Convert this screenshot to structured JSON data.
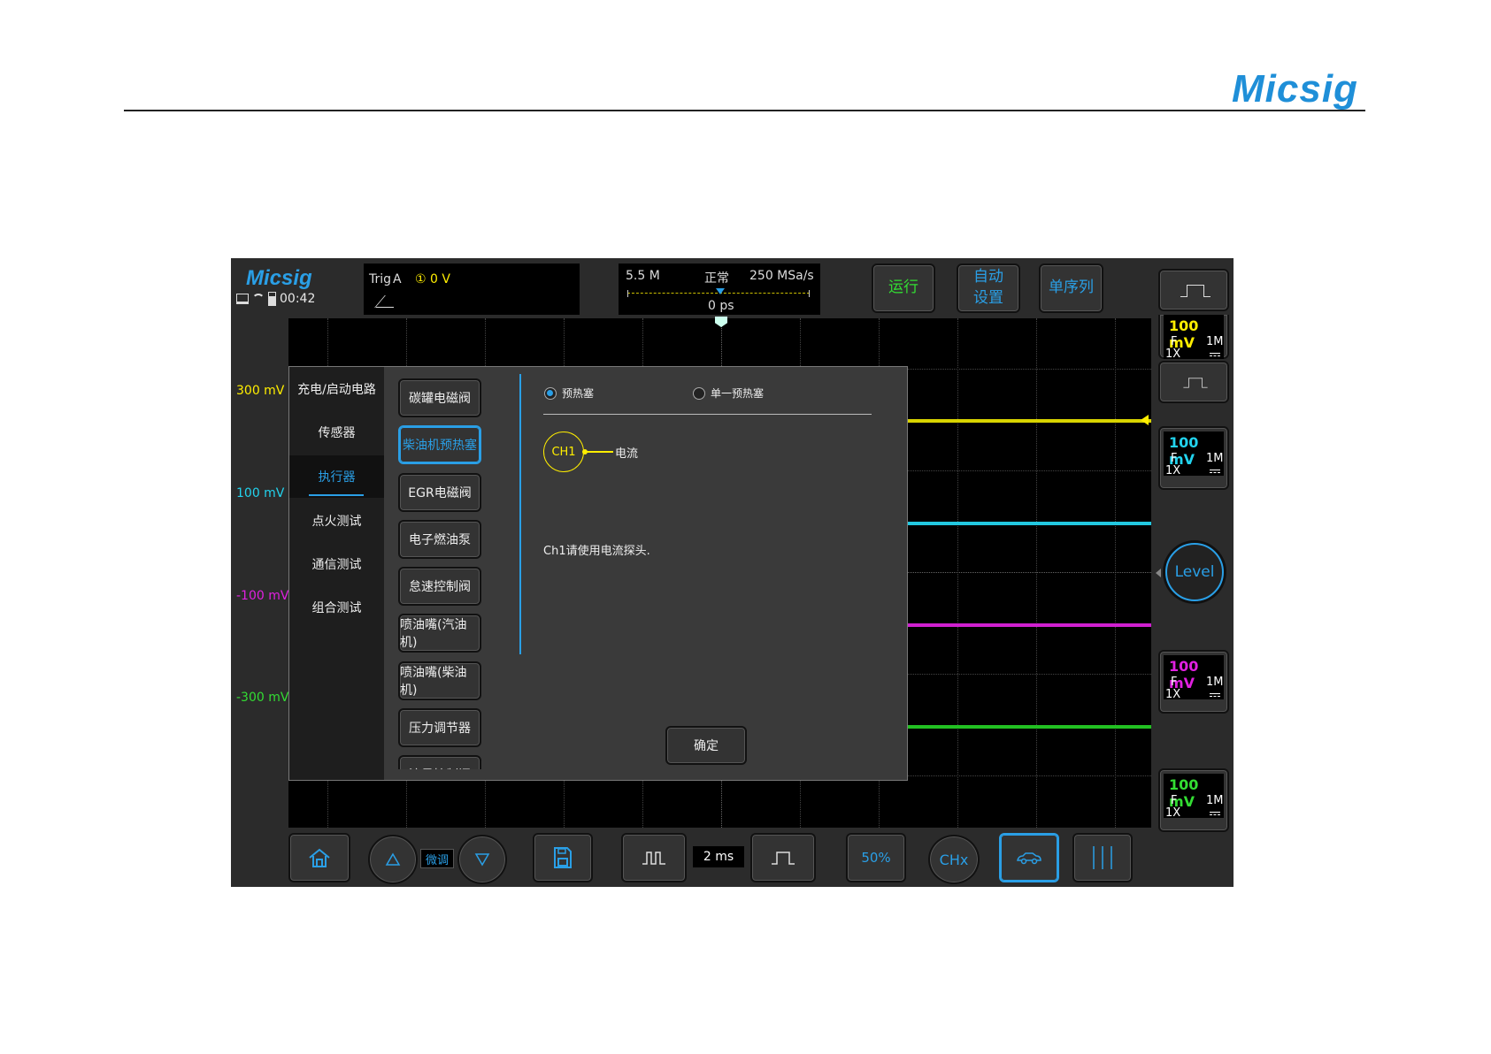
{
  "page_header": {
    "logo": "Micsig"
  },
  "device": {
    "logo": "Micsig",
    "status": {
      "time": "00:42",
      "icons": [
        "monitor-icon",
        "wifi-icon",
        "battery-icon"
      ]
    },
    "trigger": {
      "label": "Trig",
      "source": "A",
      "channel_level": "① 0 V"
    },
    "acquisition": {
      "memory": "5.5 M",
      "mode": "正常",
      "sample_rate": "250 MSa/s",
      "offset": "0 ps"
    },
    "buttons": {
      "run": "运行",
      "auto_line1": "自动",
      "auto_line2": "设置",
      "single": "单序列"
    },
    "channel_labels": [
      {
        "text": "300 mV",
        "color": "#ffee00"
      },
      {
        "text": "100 mV",
        "color": "#22d3ee"
      },
      {
        "text": "-100 mV",
        "color": "#e020e0"
      },
      {
        "text": "-300 mV",
        "color": "#33dd33"
      }
    ],
    "channels": [
      {
        "scale": "100 mV",
        "coupling": "F",
        "impedance": "1M",
        "probe": "1X",
        "color": "#ffee00"
      },
      {
        "scale": "100 mV",
        "coupling": "F",
        "impedance": "1M",
        "probe": "1X",
        "color": "#22d3ee"
      },
      {
        "scale": "100 mV",
        "coupling": "F",
        "impedance": "1M",
        "probe": "1X",
        "color": "#e020e0"
      },
      {
        "scale": "100 mV",
        "coupling": "F",
        "impedance": "1M",
        "probe": "1X",
        "color": "#33dd33"
      }
    ],
    "level_button": "Level",
    "toolbar": {
      "fine": "微调",
      "timebase": "2 ms",
      "fifty": "50%",
      "chx": "CHx"
    }
  },
  "dialog": {
    "categories": [
      "充电/启动电路",
      "传感器",
      "执行器",
      "点火测试",
      "通信测试",
      "组合测试"
    ],
    "active_category": "执行器",
    "actuators": [
      "碳罐电磁阀",
      "柴油机预热塞",
      "EGR电磁阀",
      "电子燃油泵",
      "怠速控制阀",
      "喷油嘴(汽油机)",
      "喷油嘴(柴油机)",
      "压力调节器",
      "流量控制阀"
    ],
    "active_actuator": "柴油机预热塞",
    "options": {
      "opt1": "预热塞",
      "opt2": "单一预热塞",
      "selected": "预热塞"
    },
    "probe": {
      "channel": "CH1",
      "signal": "电流"
    },
    "note": "Ch1请使用电流探头.",
    "confirm": "确定"
  }
}
